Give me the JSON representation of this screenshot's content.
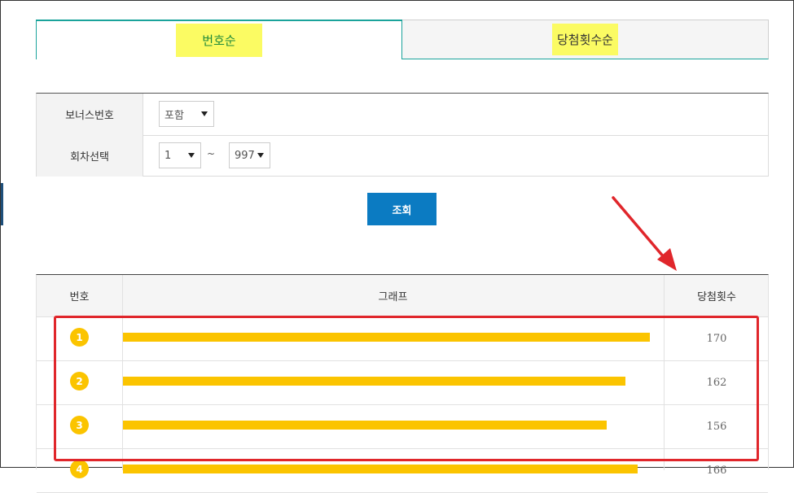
{
  "tabs": [
    {
      "label": "번호순",
      "active": true
    },
    {
      "label": "당첨횟수순",
      "active": false
    }
  ],
  "filter": {
    "bonus_label": "보너스번호",
    "bonus_value": "포함",
    "round_label": "회차선택",
    "round_from": "1",
    "round_separator": "~",
    "round_to": "997"
  },
  "search_button": "조회",
  "table": {
    "headers": {
      "number": "번호",
      "graph": "그래프",
      "count": "당첨횟수"
    },
    "rows": [
      {
        "number": "1",
        "count": "170",
        "count_value": 170
      },
      {
        "number": "2",
        "count": "162",
        "count_value": 162
      },
      {
        "number": "3",
        "count": "156",
        "count_value": 156
      },
      {
        "number": "4",
        "count": "166",
        "count_value": 166
      }
    ],
    "max_count": 175
  },
  "colors": {
    "ball": "#fbc400",
    "bar": "#fbc400",
    "button": "#0b7bc2",
    "highlight": "#e0262b",
    "tab_active_text": "#208a3a"
  }
}
